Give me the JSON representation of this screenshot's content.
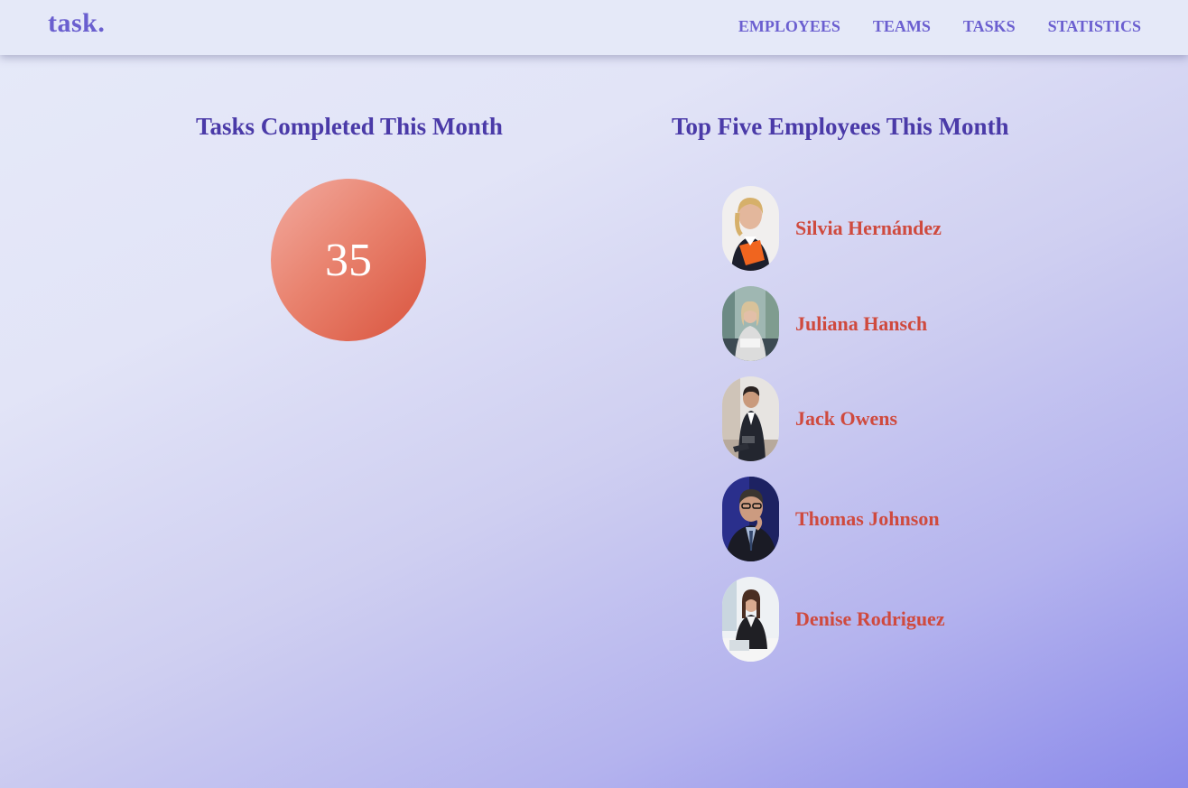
{
  "brand": {
    "logo": "task."
  },
  "nav": {
    "items": [
      {
        "label": "EMPLOYEES"
      },
      {
        "label": "TEAMS"
      },
      {
        "label": "TASKS"
      },
      {
        "label": "STATISTICS"
      }
    ]
  },
  "tasks_section": {
    "title": "Tasks Completed This Month",
    "count": "35"
  },
  "top_section": {
    "title": "Top Five Employees This Month",
    "employees": [
      {
        "name": "Silvia Hernández",
        "avatar_icon": "person-photo-icon"
      },
      {
        "name": "Juliana Hansch",
        "avatar_icon": "person-photo-icon"
      },
      {
        "name": "Jack Owens",
        "avatar_icon": "person-photo-icon"
      },
      {
        "name": "Thomas Johnson",
        "avatar_icon": "person-photo-icon"
      },
      {
        "name": "Denise Rodriguez",
        "avatar_icon": "person-photo-icon"
      }
    ]
  },
  "colors": {
    "accent": "#6b5fd0",
    "heading": "#4a3aa8",
    "name": "#cf4a3e",
    "circle_start": "#f2aba0",
    "circle_end": "#d9533d"
  }
}
